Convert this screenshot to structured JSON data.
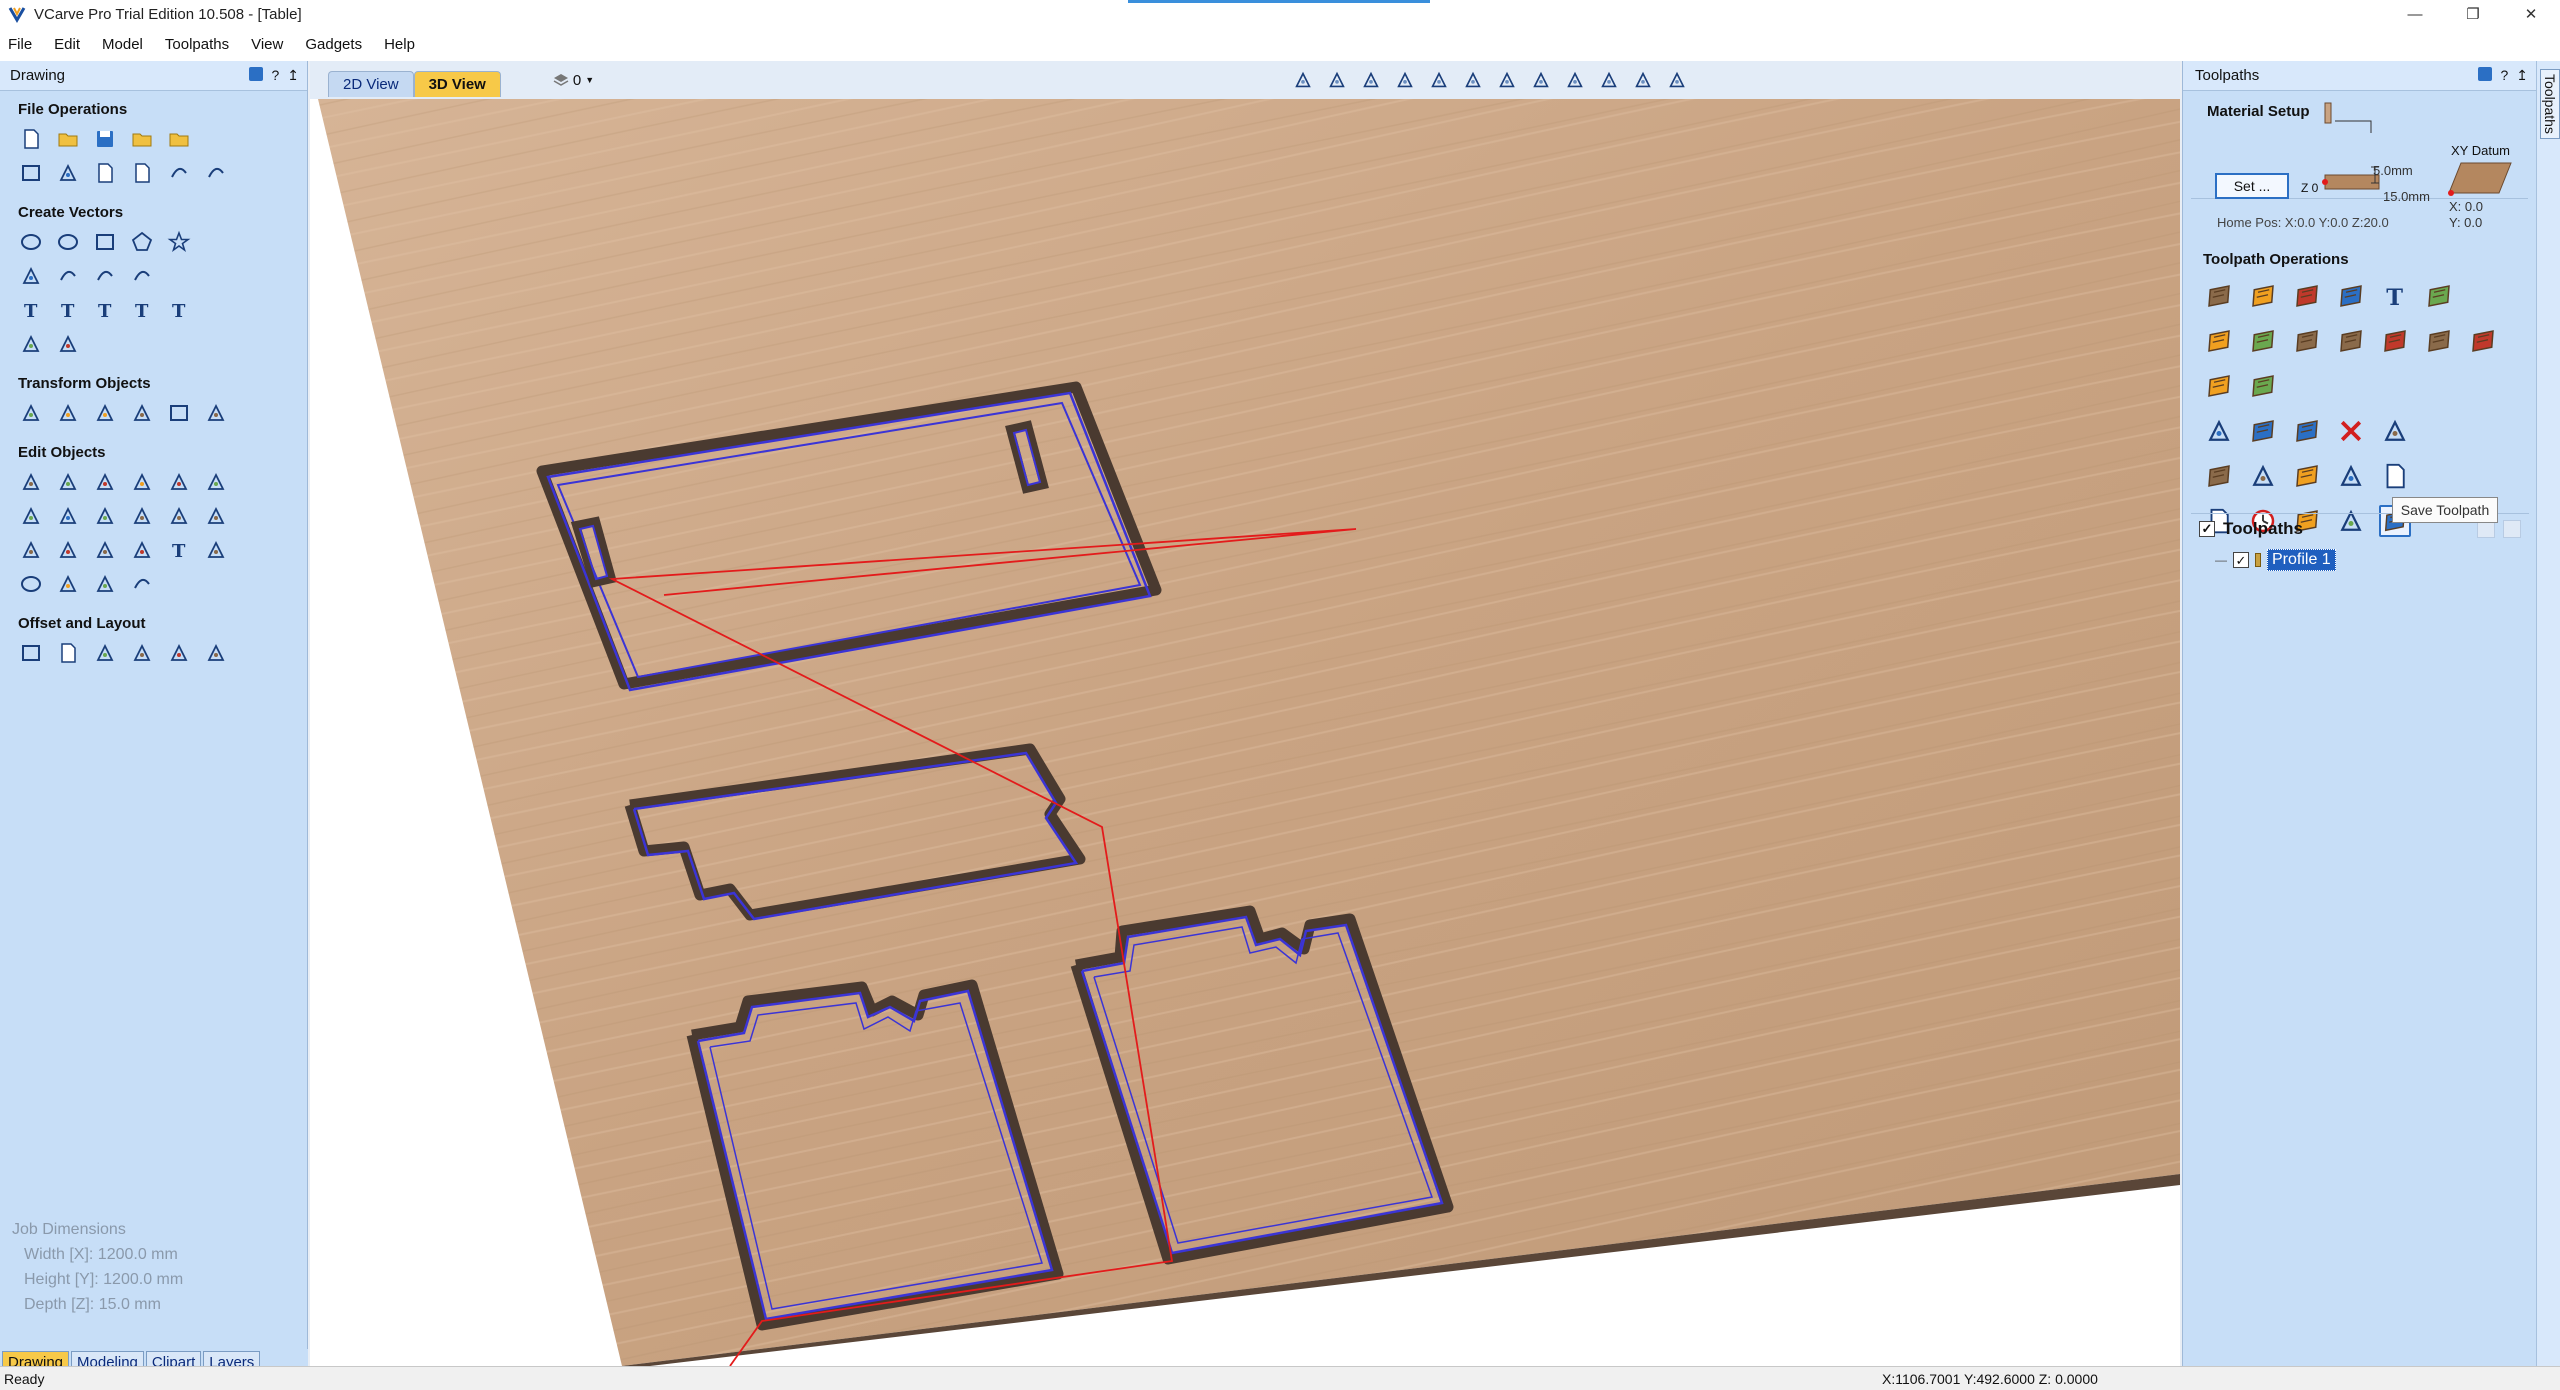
{
  "window": {
    "title": "VCarve Pro Trial Edition 10.508 - [Table]",
    "controls": [
      "—",
      "❐",
      "✕"
    ]
  },
  "menu": [
    "File",
    "Edit",
    "Model",
    "Toolpaths",
    "View",
    "Gadgets",
    "Help"
  ],
  "left_panel": {
    "title": "Drawing",
    "header_controls": [
      "?",
      "↥"
    ],
    "sections": [
      {
        "title": "File Operations",
        "rows": [
          [
            "new-file-icon",
            "open-file-icon",
            "save-icon",
            "open-folder-icon",
            "import-icon"
          ],
          [
            "select-all-icon",
            "cut-icon",
            "copy-icon",
            "paste-icon",
            "undo-icon",
            "redo-icon"
          ]
        ]
      },
      {
        "title": "Create Vectors",
        "rows": [
          [
            "circle-icon",
            "ellipse-icon",
            "rectangle-icon",
            "polygon-icon",
            "star-icon"
          ],
          [
            "polyline-icon",
            "arc-icon",
            "curve-icon",
            "spiral-icon"
          ],
          [
            "text-icon",
            "text-box-icon",
            "text-on-curve-icon",
            "auto-layout-text-icon",
            "bend-text-icon"
          ],
          [
            "dimension-icon",
            "measure-icon"
          ]
        ]
      },
      {
        "title": "Transform Objects",
        "rows": [
          [
            "move-icon",
            "scale-icon",
            "align-icon",
            "mirror-icon",
            "size-icon",
            "center-icon"
          ]
        ]
      },
      {
        "title": "Edit Objects",
        "rows": [
          [
            "select-icon",
            "node-edit-icon",
            "group-select-icon",
            "group-icon",
            "ungroup-icon",
            "trim-icon"
          ],
          [
            "weld-icon",
            "subtract-icon",
            "intersect-icon",
            "fillet-icon",
            "cut-objects-icon",
            "smooth-icon"
          ],
          [
            "corner-icon",
            "dogbone-icon",
            "extend-icon",
            "connect-icon",
            "vector-texture-icon",
            "bitmap-icon"
          ],
          [
            "oval-icon",
            "close-icon",
            "join-icon",
            "curve-fit-icon"
          ]
        ]
      },
      {
        "title": "Offset and Layout",
        "rows": [
          [
            "offset-icon",
            "array-copy-icon",
            "circular-array-icon",
            "step-repeat-icon",
            "nesting-icon",
            "auto-layout-icon"
          ]
        ]
      }
    ],
    "job_dimensions": {
      "title": "Job Dimensions",
      "lines": [
        "Width  [X]: 1200.0 mm",
        "Height [Y]: 1200.0 mm",
        "Depth  [Z]: 15.0 mm"
      ]
    },
    "tabs": [
      "Drawing",
      "Modeling",
      "Clipart",
      "Layers"
    ],
    "active_tab": "Drawing"
  },
  "view_toolbar": {
    "tabs": [
      "2D View",
      "3D View"
    ],
    "active_tab": "3D View",
    "layer_selector": "0",
    "tools": [
      "zoom-extents-icon",
      "zoom-material-icon",
      "grid-icon",
      "pan-icon",
      "zoom-icon",
      "zoom-box-icon",
      "zoom-selected-icon",
      "view-iso-icon",
      "view-top-icon",
      "shade-icon",
      "split-horizontal-icon",
      "split-vertical-icon"
    ]
  },
  "right_panel": {
    "title": "Toolpaths",
    "header_controls": [
      "?",
      "↥",
      "✕"
    ],
    "material_setup": {
      "title": "Material Setup",
      "set_button": "Set ...",
      "z_zero": "Z 0",
      "thickness_top": "5.0mm",
      "thickness_total": "15.0mm",
      "xy_datum": "XY Datum",
      "x_value": "X: 0.0",
      "y_value": "Y: 0.0",
      "home_pos": "Home Pos:   X:0.0 Y:0.0 Z:20.0"
    },
    "toolpath_operations": {
      "title": "Toolpath Operations",
      "rows": [
        [
          "profile-toolpath-icon",
          "pocket-toolpath-icon",
          "drilling-toolpath-icon",
          "quick-engrave-icon",
          "texture-toolpath-icon",
          "inlay-toolpath-icon"
        ],
        [
          "vcarve-toolpath-icon",
          "prism-toolpath-icon",
          "fluting-toolpath-icon",
          "chamfer-toolpath-icon",
          "moulding-toolpath-icon",
          "3d-roughing-icon",
          "3d-finishing-icon"
        ],
        [
          "3d-profile-icon",
          "3d-cutout-icon"
        ],
        [
          "tool-database-icon",
          "edit-toolpath-icon",
          "duplicate-toolpath-icon",
          "delete-toolpath-icon",
          "recalculate-icon"
        ],
        [
          "preview-toolpath-icon",
          "preview-all-icon",
          "merge-toolpaths-icon",
          "template-icon",
          "summary-icon"
        ],
        [
          "job-sheet-icon",
          "time-estimate-icon",
          "toolpath-adjust-icon",
          "post-processor-icon",
          "save-toolpath-icon"
        ]
      ]
    },
    "tooltip": "Save Toolpath",
    "toolpaths_list": {
      "title": "Toolpaths",
      "checked": true,
      "items": [
        {
          "name": "Profile 1",
          "checked": true
        }
      ]
    },
    "side_tab": "Toolpaths"
  },
  "status_bar": {
    "status": "Ready",
    "coordinates": "X:1106.7001 Y:492.6000 Z: 0.0000"
  },
  "colors": {
    "panel_bg": "#c7def7",
    "active_tab": "#f7c948",
    "wood": "#c9a382",
    "toolpath_line": "#3b34d6",
    "rapid_move": "#e31b1b"
  }
}
